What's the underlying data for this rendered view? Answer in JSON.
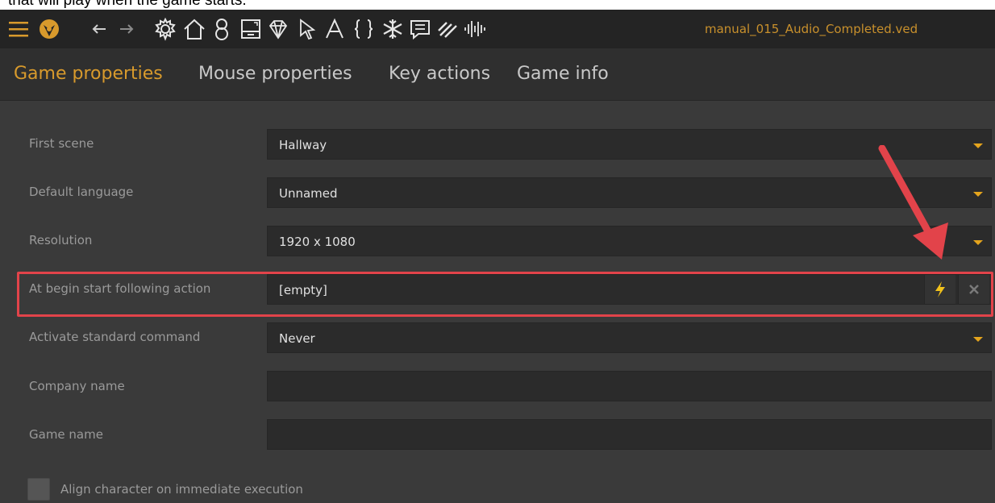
{
  "caption": "that will play when the game starts.",
  "toolbar": {
    "icons": [
      "menu-icon",
      "logo-icon",
      "back-icon",
      "forward-icon",
      "gear-icon",
      "home-icon",
      "character-icon",
      "scene-icon",
      "diamond-icon",
      "cursor-icon",
      "font-icon",
      "braces-icon",
      "snowflake-icon",
      "chat-icon",
      "stripes-icon",
      "audio-icon"
    ],
    "filename": "manual_015_Audio_Completed.ved"
  },
  "tabs": [
    {
      "label": "Game properties",
      "active": true
    },
    {
      "label": "Mouse properties",
      "active": false
    },
    {
      "label": "Key actions",
      "active": false
    },
    {
      "label": "Game info",
      "active": false
    }
  ],
  "form": {
    "first_scene": {
      "label": "First scene",
      "value": "Hallway"
    },
    "default_language": {
      "label": "Default language",
      "value": "Unnamed"
    },
    "resolution": {
      "label": "Resolution",
      "value": "1920 x 1080"
    },
    "begin_action": {
      "label": "At begin start following action",
      "value": "[empty]",
      "action_icon": "lightning-icon",
      "clear_icon": "close-icon"
    },
    "standard_command": {
      "label": "Activate standard command",
      "value": "Never"
    },
    "company_name": {
      "label": "Company name",
      "value": ""
    },
    "game_name": {
      "label": "Game name",
      "value": ""
    },
    "align_character": {
      "label": "Align character on immediate execution",
      "checked": false
    }
  },
  "colors": {
    "accent": "#d89a2c",
    "highlight": "#e2434a",
    "background": "#3a3a3a",
    "toolbar": "#242424"
  }
}
